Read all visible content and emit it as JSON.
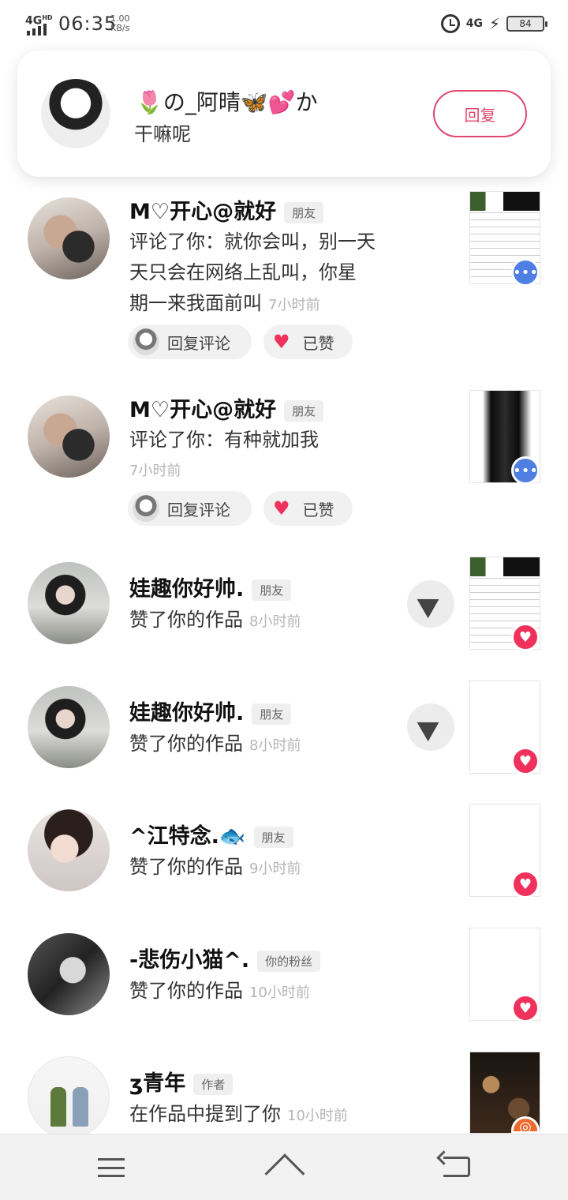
{
  "status_bar": {
    "network": "4G",
    "network_sup": "HD",
    "time": "06:35",
    "speed_value": "1.00",
    "speed_unit": "KB/s",
    "right_network": "4G",
    "battery": "84"
  },
  "notification_card": {
    "sender": "🌷の_阿晴🦋💕か",
    "message": "干嘛呢",
    "reply_label": "回复"
  },
  "items": [
    {
      "name": "M♡开心@就好",
      "tag": "朋友",
      "text_line1": "评论了你：就你会叫，别一天",
      "text_line2": "天只会在网络上乱叫，你星",
      "text_line3": "期一来我面前叫",
      "time": "7小时前",
      "reply_label": "回复评论",
      "like_label": "已赞"
    },
    {
      "name": "M♡开心@就好",
      "tag": "朋友",
      "text_line1": "评论了你：有种就加我",
      "time": "7小时前",
      "reply_label": "回复评论",
      "like_label": "已赞"
    },
    {
      "name": "娃趣你好帅.",
      "tag": "朋友",
      "text": "赞了你的作品",
      "time": "8小时前"
    },
    {
      "name": "娃趣你好帅.",
      "tag": "朋友",
      "text": "赞了你的作品",
      "time": "8小时前"
    },
    {
      "name": "^江特念.🐟",
      "tag": "朋友",
      "text": "赞了你的作品",
      "time": "9小时前"
    },
    {
      "name": "-悲伤小猫^.",
      "tag": "你的粉丝",
      "text": "赞了你的作品",
      "time": "10小时前"
    },
    {
      "name": "ʒ青年",
      "tag": "作者",
      "text": "在作品中提到了你",
      "time": "10小时前"
    }
  ],
  "colors": {
    "accent_pink": "#e0476f",
    "like_red": "#f0315c",
    "comment_blue": "#4f7fe3"
  }
}
